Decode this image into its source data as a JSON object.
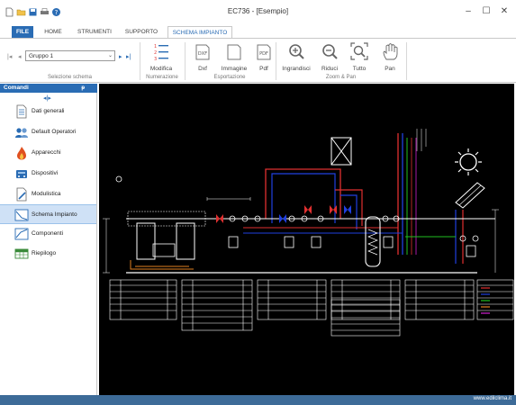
{
  "window": {
    "title": "EC736 - [Esempio]",
    "controls": {
      "minimize": "–",
      "maximize": "☐",
      "close": "✕"
    }
  },
  "menu": {
    "tabs": [
      "FILE",
      "HOME",
      "STRUMENTI",
      "SUPPORTO",
      "SCHEMA IMPIANTO"
    ],
    "active_index": 4
  },
  "ribbon": {
    "selection": {
      "group_value": "Gruppo 1",
      "label": "Selezione schema"
    },
    "numbering": {
      "modify": "Modifica",
      "label": "Numerazione"
    },
    "export": {
      "dxf": "Dxf",
      "image": "Immagine",
      "pdf": "Pdf",
      "label": "Esportazione",
      "dxf_badge": "DXF",
      "pdf_badge": "PDF"
    },
    "zoom": {
      "zoom_in": "Ingrandisci",
      "zoom_out": "Riduci",
      "zoom_all": "Tutto",
      "pan": "Pan",
      "label": "Zoom & Pan"
    }
  },
  "sidebar": {
    "title": "Comandi",
    "pin": "ᵽ",
    "items": [
      {
        "label": "Dati generali",
        "icon": "document-icon"
      },
      {
        "label": "Default Operatori",
        "icon": "users-icon"
      },
      {
        "label": "Apparecchi",
        "icon": "flame-icon"
      },
      {
        "label": "Dispositivi",
        "icon": "devices-icon"
      },
      {
        "label": "Modulistica",
        "icon": "forms-icon"
      },
      {
        "label": "Schema Impianto",
        "icon": "schema-icon"
      },
      {
        "label": "Componenti",
        "icon": "components-icon"
      },
      {
        "label": "Riepilogo",
        "icon": "table-icon"
      }
    ],
    "active_index": 5
  },
  "status": {
    "website": "www.edilclima.it"
  },
  "colors": {
    "accent": "#2a6cb4",
    "status_bar": "#3d6b98",
    "canvas_bg": "#000000",
    "pipe_red": "#e03030",
    "pipe_blue": "#2040e0",
    "pipe_green": "#20c020",
    "pipe_orange": "#e08020",
    "pipe_magenta": "#d020d0"
  }
}
